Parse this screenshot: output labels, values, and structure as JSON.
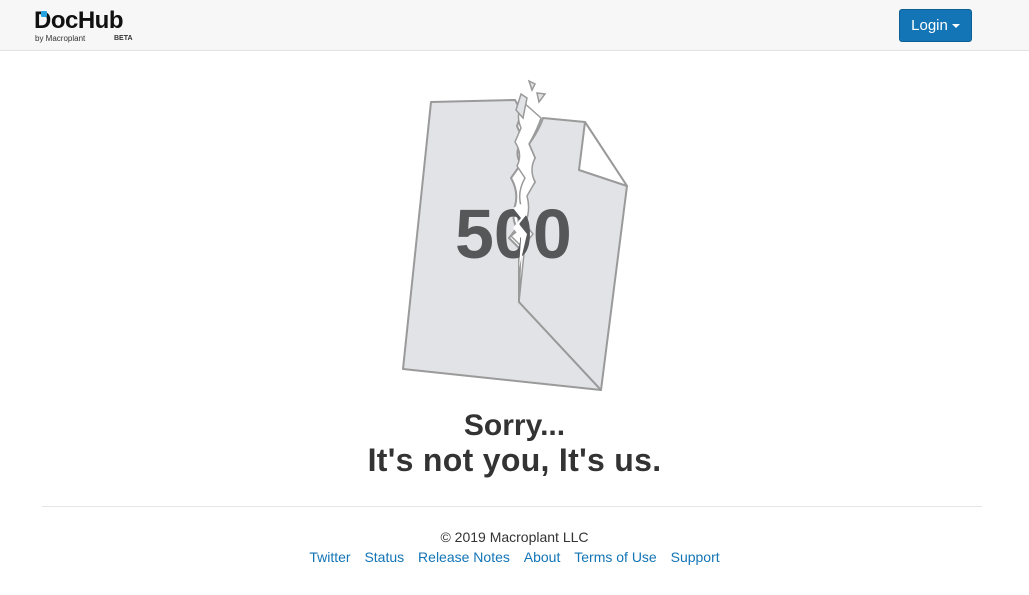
{
  "header": {
    "logo": {
      "name": "DocHub",
      "byline": "by Macroplant",
      "badge": "BETA",
      "accent_color": "#27a4e0"
    },
    "login_button": {
      "label": "Login",
      "icon": "caret-down-icon",
      "color": "#1375b6"
    }
  },
  "main": {
    "error_code": "500",
    "illustration_icon": "torn-document-icon",
    "headline": "Sorry...",
    "subheadline": "It's not you, It's us."
  },
  "footer": {
    "copyright": "© 2019 Macroplant LLC",
    "links": [
      "Twitter",
      "Status",
      "Release Notes",
      "About",
      "Terms of Use",
      "Support"
    ],
    "link_color": "#1375b6"
  }
}
